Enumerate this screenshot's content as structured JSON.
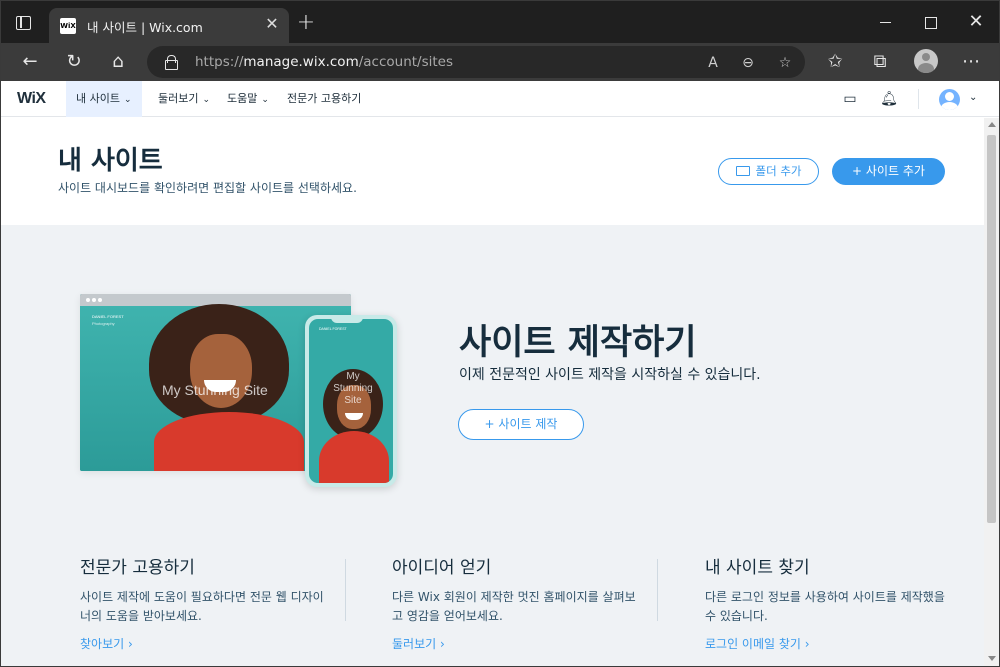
{
  "browser": {
    "tab_title": "내 사이트 | Wix.com",
    "tab_favicon": "WiX",
    "url_prefix": "https://",
    "url_domain": "manage.wix.com",
    "url_path": "/account/sites"
  },
  "header": {
    "logo": "WiX",
    "menu": [
      {
        "label": "내 사이트"
      },
      {
        "label": "둘러보기"
      },
      {
        "label": "도움말"
      },
      {
        "label": "전문가 고용하기"
      }
    ]
  },
  "page": {
    "title": "내 사이트",
    "subtitle": "사이트 대시보드를 확인하려면 편집할 사이트를 선택하세요.",
    "add_folder_label": "폴더 추가",
    "add_site_label": "+ 사이트 추가"
  },
  "hero": {
    "title": "사이트 제작하기",
    "subtitle": "이제 전문적인 사이트 제작을 시작하실 수 있습니다.",
    "create_label": "+ 사이트 제작",
    "mock_brand": "DANIEL FOREST",
    "mock_brand_sub": "Photography",
    "mock_headline": "My Stunning Site",
    "mock_phone_headline": "My Stunning Site"
  },
  "columns": [
    {
      "title": "전문가 고용하기",
      "text": "사이트 제작에 도움이 필요하다면 전문 웹 디자이너의 도움을 받아보세요.",
      "link": "찾아보기 ›"
    },
    {
      "title": "아이디어 얻기",
      "text": "다른 Wix 회원이 제작한 멋진 홈페이지를 살펴보고 영감을 얻어보세요.",
      "link": "둘러보기 ›"
    },
    {
      "title": "내 사이트 찾기",
      "text": "다른 로그인 정보를 사용하여 사이트를 제작했을 수 있습니다.",
      "link": "로그인 이메일 찾기 ›"
    }
  ]
}
